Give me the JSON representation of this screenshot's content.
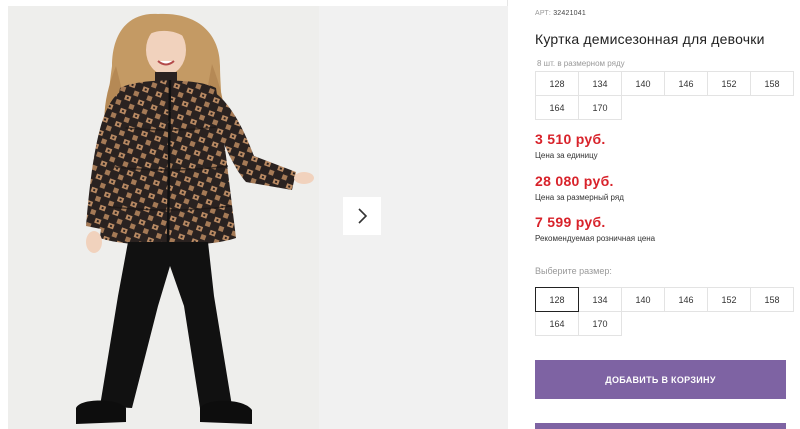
{
  "product": {
    "sku_prefix": "АРТ:",
    "sku": "32421041",
    "title": "Куртка демисезонная для девочки",
    "pack_note": "8 шт. в размерном ряду",
    "pack_sizes": [
      "128",
      "134",
      "140",
      "146",
      "152",
      "158",
      "164",
      "170"
    ],
    "prices": [
      {
        "value": "3 510 руб.",
        "label": "Цена за единицу"
      },
      {
        "value": "28 080 руб.",
        "label": "Цена за размерный ряд"
      },
      {
        "value": "7 599 руб.",
        "label": "Рекомендуемая розничная цена"
      }
    ],
    "choose_size_label": "Выберите размер:",
    "selectable_sizes": [
      "128",
      "134",
      "140",
      "146",
      "152",
      "158",
      "164",
      "170"
    ],
    "selected_size": "128",
    "add_to_cart_label": "ДОБАВИТЬ В КОРЗИНУ"
  },
  "gallery": {
    "next_icon": "chevron-right-icon"
  },
  "colors": {
    "price": "#d8222a",
    "button": "#7e63a3",
    "jacket": "#2a2220",
    "pattern": "#b98a63",
    "pants": "#111111"
  }
}
